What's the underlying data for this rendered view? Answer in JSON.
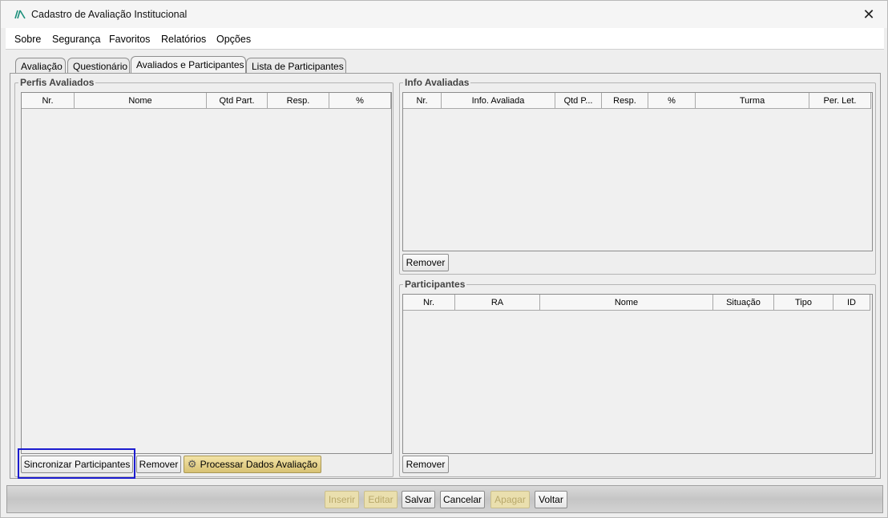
{
  "window": {
    "title": "Cadastro de Avaliação Institucional",
    "close_glyph": "✕"
  },
  "menu": {
    "items": [
      "Sobre",
      "Segurança",
      "Favoritos",
      "Relatórios",
      "Opções"
    ]
  },
  "tabs": [
    "Avaliação",
    "Questionário",
    "Avaliados e Participantes",
    "Lista de Participantes"
  ],
  "active_tab": "Avaliados e Participantes",
  "perfis": {
    "title": "Perfis Avaliados",
    "columns": [
      "Nr.",
      "Nome",
      "Qtd Part.",
      "Resp.",
      "%"
    ],
    "sync_button": "Sincronizar Participantes",
    "remove_button": "Remover",
    "process_button": "Processar Dados Avaliação"
  },
  "info": {
    "title": "Info Avaliadas",
    "columns": [
      "Nr.",
      "Info. Avaliada",
      "Qtd P...",
      "Resp.",
      "%",
      "Turma",
      "Per. Let."
    ],
    "remove_button": "Remover"
  },
  "participantes": {
    "title": "Participantes",
    "columns": [
      "Nr.",
      "RA",
      "Nome",
      "Situação",
      "Tipo",
      "ID"
    ],
    "remove_button": "Remover"
  },
  "footer": {
    "inserir": "Inserir",
    "editar": "Editar",
    "salvar": "Salvar",
    "cancelar": "Cancelar",
    "apagar": "Apagar",
    "voltar": "Voltar"
  },
  "colors": {
    "highlight": "#1c1ccf",
    "logo": "#1a8f7a",
    "gold": "#d8c274"
  }
}
